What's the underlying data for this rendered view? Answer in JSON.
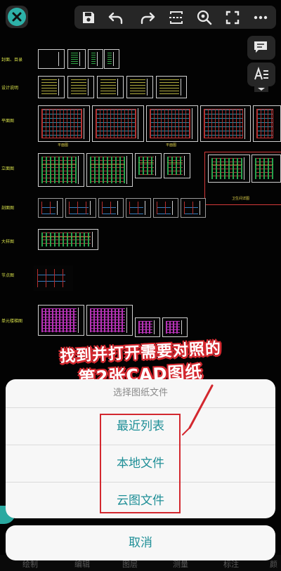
{
  "row_labels": [
    "封面、目录",
    "设计说明",
    "平面图",
    "立面图",
    "剖面图",
    "大样图",
    "节点图",
    "单元楼梯图"
  ],
  "drawing_notes": [
    "平面图",
    "平面图",
    "卫生间详图"
  ],
  "annotation": {
    "line1": "找到并打开需要对照的",
    "line2": "第2张CAD图纸",
    "color": "#d3282f"
  },
  "sheet_dialog": {
    "title": "选择图纸文件",
    "options": [
      "最近列表",
      "本地文件",
      "云图文件"
    ],
    "cancel": "取消",
    "accent": "#1f8f97"
  },
  "bottom_nav": [
    "绘制",
    "编辑",
    "图层",
    "测量",
    "标注",
    "颜"
  ],
  "toolbar_icons": [
    "close-icon",
    "save-icon",
    "undo-icon",
    "redo-icon",
    "frame-icon",
    "zoom-icon",
    "fullscreen-icon",
    "more-icon"
  ],
  "side_icons": [
    "comment-icon",
    "text-style-icon"
  ]
}
